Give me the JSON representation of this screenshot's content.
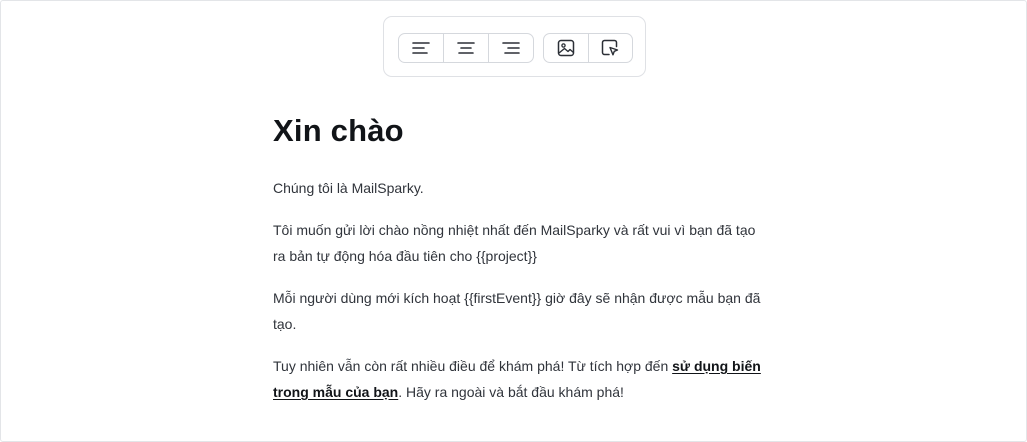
{
  "toolbar": {
    "buttons": [
      {
        "icon": "align-left-icon"
      },
      {
        "icon": "align-center-icon"
      },
      {
        "icon": "align-right-icon"
      },
      {
        "icon": "image-icon"
      },
      {
        "icon": "cursor-select-icon"
      }
    ]
  },
  "content": {
    "title": "Xin chào",
    "p1": "Chúng tôi là MailSparky.",
    "p2_line1": "Tôi muốn gửi lời chào nồng nhiệt nhất đến MailSparky và rất vui vì bạn đã tạo",
    "p2_line2": "ra bản tự động hóa đầu tiên cho {{project}}",
    "p3_line1": "Mỗi người dùng mới kích hoạt {{firstEvent}} giờ đây sẽ nhận được mẫu bạn đã",
    "p3_line2": "tạo.",
    "p4_line1_text": "Tuy nhiên vẫn còn rất nhiều điều để khám phá! Từ tích hợp đến ",
    "p4_link_part1": "sử dụng biến",
    "p4_link_part2": "trong mẫu của bạn",
    "p4_line2_tail": ". Hãy ra ngoài và bắt đầu khám phá!"
  },
  "colors": {
    "title": "#111418",
    "body_text": "#30343b",
    "border": "#dfe1e5"
  }
}
